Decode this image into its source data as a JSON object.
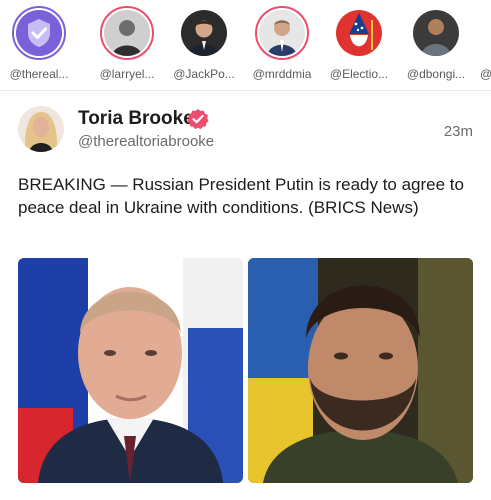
{
  "stories": [
    {
      "handle": "@thereal...",
      "avatar_icon": "verified-shield-icon"
    },
    {
      "handle": "@larryel...",
      "avatar_icon": "person-avatar"
    },
    {
      "handle": "@JackPo...",
      "avatar_icon": "person-avatar"
    },
    {
      "handle": "@mrddmia",
      "avatar_icon": "person-avatar"
    },
    {
      "handle": "@Electio...",
      "avatar_icon": "wizard-avatar"
    },
    {
      "handle": "@dbongi...",
      "avatar_icon": "person-avatar"
    },
    {
      "handle": "@"
    }
  ],
  "post": {
    "author_name": "Toria Brooke",
    "author_handle": "@therealtoriabrooke",
    "time": "23m",
    "verified_icon": "verified-badge-icon",
    "text": "BREAKING — Russian President Putin is ready to agree to peace deal in Ukraine with conditions. (BRICS News)",
    "images": [
      {
        "subject": "putin-photo"
      },
      {
        "subject": "zelensky-photo"
      }
    ]
  },
  "colors": {
    "story_ring": "#ef4c6e",
    "verified_badge": "#ef4c6e",
    "accent_purple": "#7b61d9"
  }
}
